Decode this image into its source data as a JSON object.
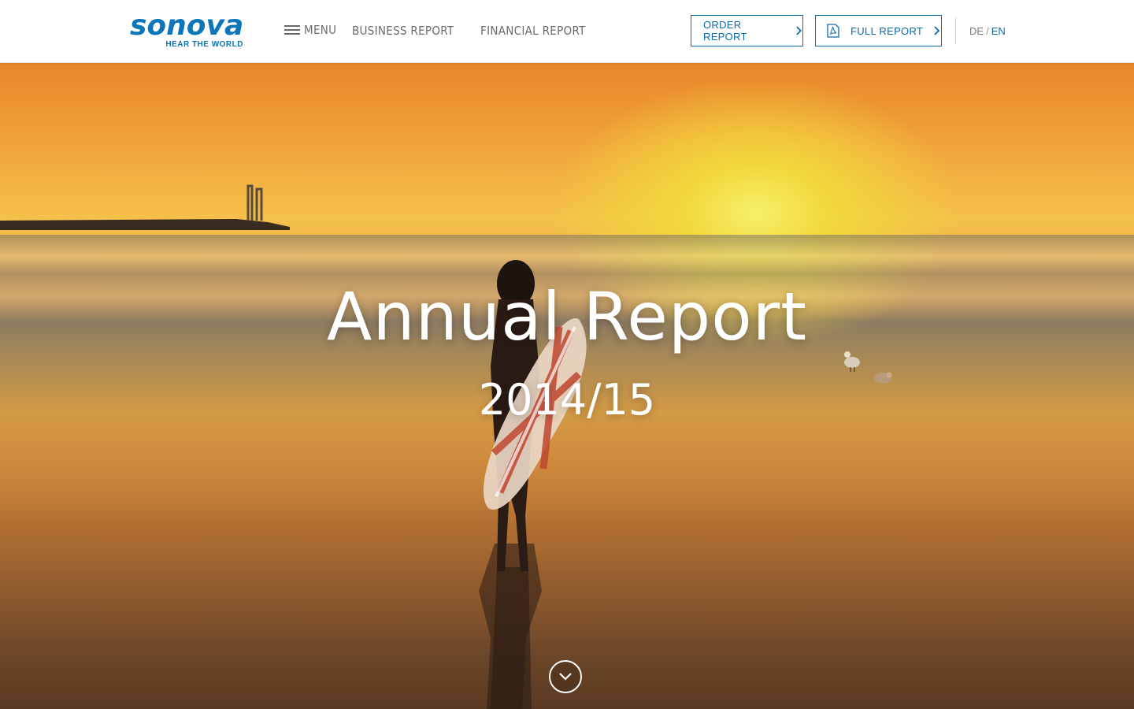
{
  "brand": {
    "name": "sonova",
    "tagline": "HEAR THE WORLD",
    "color": "#0d76b8"
  },
  "nav": {
    "menu_label": "MENU",
    "links": [
      {
        "label": "BUSINESS REPORT"
      },
      {
        "label": "FINANCIAL REPORT"
      }
    ]
  },
  "actions": {
    "order_label": "ORDER REPORT",
    "full_label": "FULL REPORT",
    "accent": "#0d6aa8"
  },
  "language": {
    "de": "DE",
    "separator": "/",
    "en": "EN",
    "active": "EN"
  },
  "hero": {
    "title": "Annual Report",
    "subtitle": "2014/15",
    "scroll_icon": "chevron-down-icon"
  }
}
